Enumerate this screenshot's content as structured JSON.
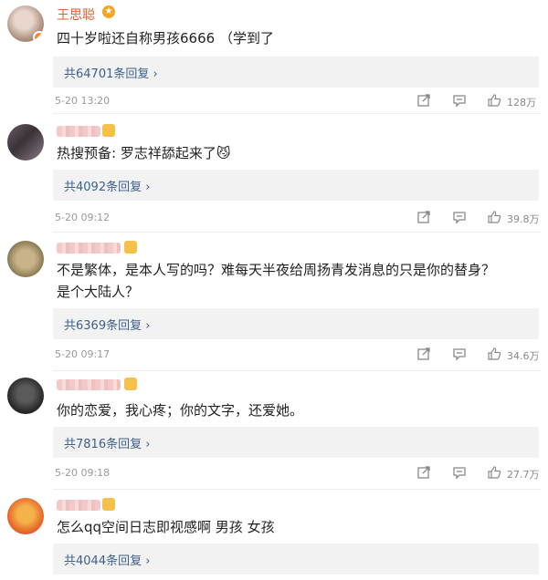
{
  "comments": [
    {
      "author": "王思聪",
      "text": "四十岁啦还自称男孩6666 （学到了",
      "replies": "共64701条回复 ›",
      "date": "5-20 13:20",
      "likes": "128万"
    },
    {
      "text": "热搜预备: 罗志祥舔起来了😼",
      "replies": "共4092条回复 ›",
      "date": "5-20 09:12",
      "likes": "39.8万"
    },
    {
      "text_line1": "不是繁体，是本人写的吗？难每天半夜给周扬青发消息的只是你的替身？",
      "text_line2": "是个大陆人？",
      "replies": "共6369条回复 ›",
      "date": "5-20 09:17",
      "likes": "34.6万"
    },
    {
      "text": "你的恋爱，我心疼；你的文字，还爱她。",
      "replies": "共7816条回复 ›",
      "date": "5-20 09:18",
      "likes": "27.7万"
    },
    {
      "text": "怎么qq空间日志即视感啊 男孩 女孩",
      "replies": "共4044条回复 ›"
    }
  ],
  "icons": {
    "share": "share-icon",
    "comment": "comment-icon",
    "like": "thumbs-up-icon"
  },
  "colors": {
    "author_name": "#e0602d",
    "reply_link": "#3c5f8f",
    "reply_bg": "#f2f2f2"
  }
}
